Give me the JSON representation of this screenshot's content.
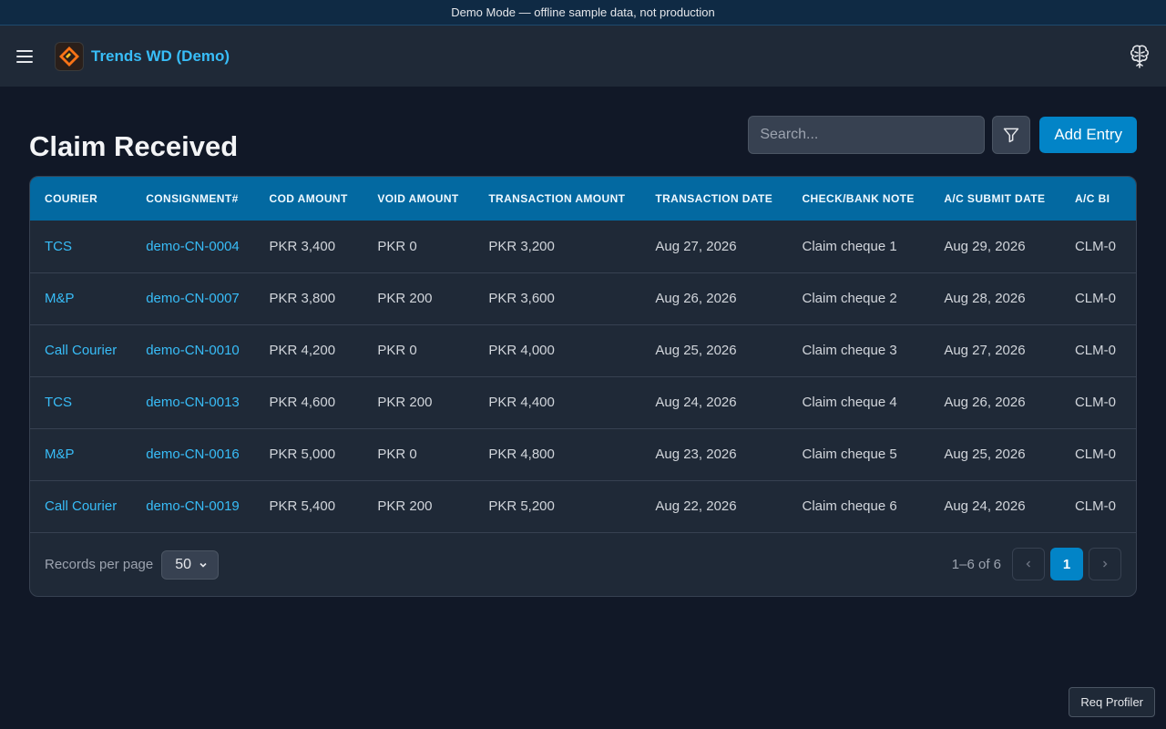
{
  "banner": {
    "text": "Demo Mode — offline sample data, not production"
  },
  "header": {
    "app_title": "Trends WD (Demo)"
  },
  "page": {
    "title": "Claim Received",
    "search_placeholder": "Search...",
    "add_label": "Add Entry"
  },
  "table": {
    "columns": [
      "COURIER",
      "CONSIGNMENT#",
      "COD AMOUNT",
      "VOID AMOUNT",
      "TRANSACTION AMOUNT",
      "TRANSACTION DATE",
      "CHECK/BANK NOTE",
      "A/C SUBMIT DATE",
      "A/C BI"
    ],
    "rows": [
      [
        "TCS",
        "demo-CN-0004",
        "PKR 3,400",
        "PKR 0",
        "PKR 3,200",
        "Aug 27, 2026",
        "Claim cheque 1",
        "Aug 29, 2026",
        "CLM-0"
      ],
      [
        "M&P",
        "demo-CN-0007",
        "PKR 3,800",
        "PKR 200",
        "PKR 3,600",
        "Aug 26, 2026",
        "Claim cheque 2",
        "Aug 28, 2026",
        "CLM-0"
      ],
      [
        "Call Courier",
        "demo-CN-0010",
        "PKR 4,200",
        "PKR 0",
        "PKR 4,000",
        "Aug 25, 2026",
        "Claim cheque 3",
        "Aug 27, 2026",
        "CLM-0"
      ],
      [
        "TCS",
        "demo-CN-0013",
        "PKR 4,600",
        "PKR 200",
        "PKR 4,400",
        "Aug 24, 2026",
        "Claim cheque 4",
        "Aug 26, 2026",
        "CLM-0"
      ],
      [
        "M&P",
        "demo-CN-0016",
        "PKR 5,000",
        "PKR 0",
        "PKR 4,800",
        "Aug 23, 2026",
        "Claim cheque 5",
        "Aug 25, 2026",
        "CLM-0"
      ],
      [
        "Call Courier",
        "demo-CN-0019",
        "PKR 5,400",
        "PKR 200",
        "PKR 5,200",
        "Aug 22, 2026",
        "Claim cheque 6",
        "Aug 24, 2026",
        "CLM-0"
      ]
    ]
  },
  "footer": {
    "records_per_page_label": "Records per page",
    "records_per_page_value": "50",
    "range": "1–6 of 6",
    "current_page": "1"
  },
  "profiler": {
    "label": "Req Profiler"
  },
  "colors": {
    "accent": "#0284c7",
    "link": "#38bdf8",
    "header_row": "#0369a1"
  }
}
